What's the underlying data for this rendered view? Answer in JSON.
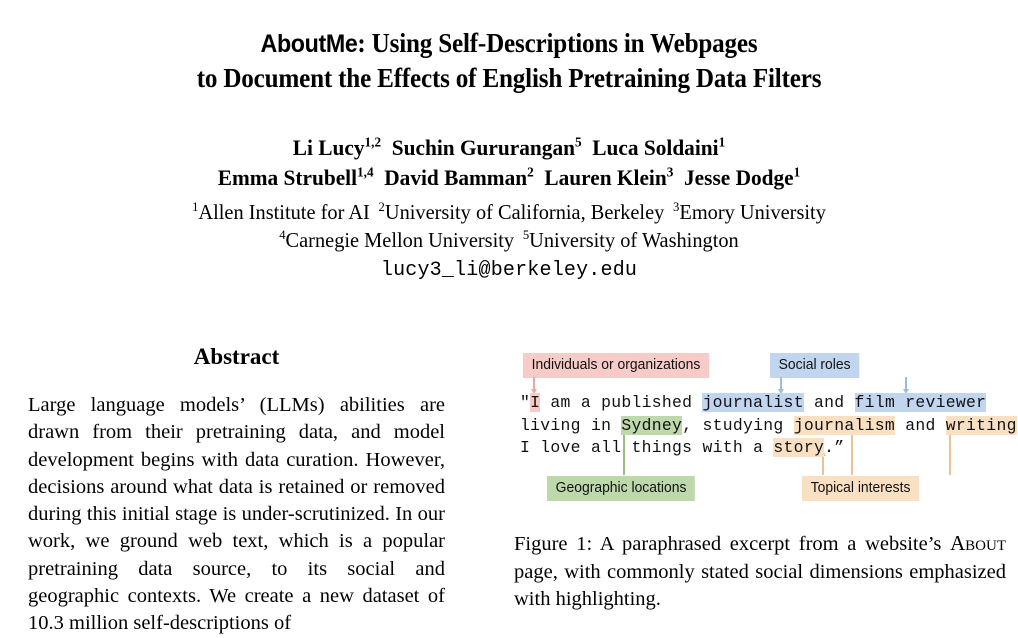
{
  "paper": {
    "title": {
      "brand_word": "AboutMe",
      "line1_rest": ": Using Self-Descriptions in Webpages",
      "line2": "to Document the Effects of English Pretraining Data Filters"
    },
    "authors": {
      "row1": [
        {
          "name": "Li Lucy",
          "affil": "1,2"
        },
        {
          "name": "Suchin Gururangan",
          "affil": "5"
        },
        {
          "name": "Luca Soldaini",
          "affil": "1"
        }
      ],
      "row2": [
        {
          "name": "Emma Strubell",
          "affil": "1,4"
        },
        {
          "name": "David Bamman",
          "affil": "2"
        },
        {
          "name": "Lauren Klein",
          "affil": "3"
        },
        {
          "name": "Jesse Dodge",
          "affil": "1"
        }
      ]
    },
    "affiliations": {
      "row1": [
        {
          "marker": "1",
          "name": "Allen Institute for AI"
        },
        {
          "marker": "2",
          "name": "University of California, Berkeley"
        },
        {
          "marker": "3",
          "name": "Emory University"
        }
      ],
      "row2": [
        {
          "marker": "4",
          "name": "Carnegie Mellon University"
        },
        {
          "marker": "5",
          "name": "University of Washington"
        }
      ]
    },
    "email": "lucy3_li@berkeley.edu"
  },
  "abstract": {
    "heading": "Abstract",
    "body": "Large language models’ (LLMs) abilities are drawn from their pretraining data, and model development begins with data curation. However, decisions around what data is retained or removed during this initial stage is under-scrutinized. In our work, we ground web text, which is a popular pretraining data source, to its social and geographic contexts. We create a new dataset of 10.3 million self-descriptions of"
  },
  "figure": {
    "labels": {
      "individuals": "Individuals or organizations",
      "social_roles": "Social roles",
      "geographic": "Geographic locations",
      "topical": "Topical interests"
    },
    "colors": {
      "individuals": "#f6cbc8",
      "social_roles": "#c2d5ee",
      "geographic": "#bdd9ab",
      "topical": "#fae0c3"
    },
    "excerpt": {
      "line1": {
        "open_quote": "\"",
        "seg_i": "I",
        "seg_a": " am a published ",
        "seg_journalist": "journalist",
        "seg_b": " and ",
        "seg_filmreviewer": "film reviewer"
      },
      "line2": {
        "seg_a": "living in ",
        "seg_sydney": "Sydney",
        "seg_b": ", studying ",
        "seg_journalism": "journalism",
        "seg_c": " and ",
        "seg_writing": "writing",
        "seg_d": "."
      },
      "line3": {
        "seg_a": "I love all things with a ",
        "seg_story": "story",
        "seg_b": ".”"
      }
    },
    "caption": {
      "label": "Figure 1:",
      "text_before": " A paraphrased excerpt from a website’s ",
      "smallcaps": "About",
      "text_after": " page, with commonly stated social dimensions emphasized with highlighting."
    }
  }
}
